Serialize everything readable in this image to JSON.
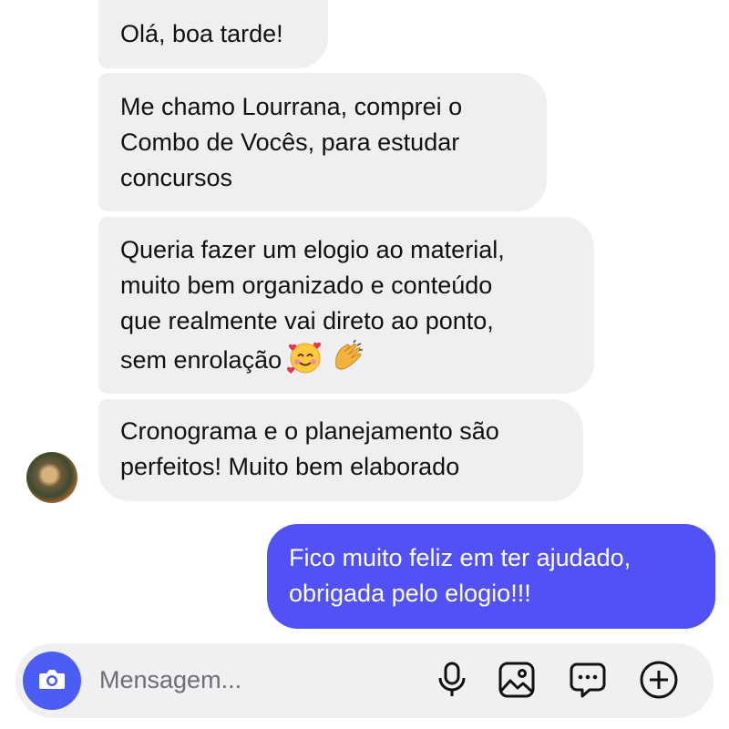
{
  "messages": [
    {
      "side": "incoming",
      "text": "Olá, boa tarde!"
    },
    {
      "side": "incoming",
      "text": "Me chamo Lourrana, comprei o\nCombo de Vocês, para estudar\nconcursos"
    },
    {
      "side": "incoming",
      "text": "Queria fazer um elogio ao material,\nmuito bem organizado e conteúdo\nque realmente vai direto ao ponto,\nsem enrolação",
      "emojis": [
        "smiling-face-with-hearts-emoji",
        "clapping-hands-emoji"
      ]
    },
    {
      "side": "incoming",
      "text": "Cronograma e o planejamento são\nperfeitos! Muito bem elaborado"
    },
    {
      "side": "outgoing",
      "text": "Fico muito feliz em ter ajudado,\nobrigada pelo elogio!!!"
    }
  ],
  "composer": {
    "placeholder": "Mensagem...",
    "value": "",
    "icons": [
      "camera-icon",
      "microphone-icon",
      "image-icon",
      "chat-bubble-icon",
      "plus-circle-icon"
    ]
  },
  "colors": {
    "incoming_bubble": "#efeff1",
    "outgoing_bubble": "#5151f5",
    "camera_button": "#4c5df5",
    "composer_bg": "#f0f0f2"
  }
}
